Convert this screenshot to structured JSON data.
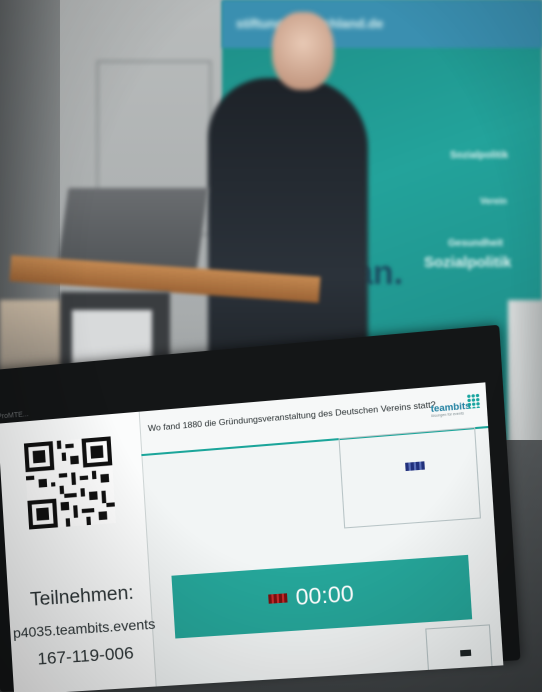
{
  "photo": {
    "description_colors": {
      "banner": "#23a39b",
      "accent": "#1ba59a",
      "timer_bar": "#26a69a"
    }
  },
  "banner": {
    "top_text": "stiftung-deutschland.de",
    "word_1": "Sozialpolitik",
    "word_2": "Verein",
    "word_3": "Gesundheit",
    "word_4": "Sozialpolitik",
    "word_5": "an."
  },
  "monitor": {
    "brand": "ProMTE..."
  },
  "screen": {
    "question": "Wo fand 1880 die Gründungsveranstaltung des Deutschen Vereins statt?",
    "logo": "teambits",
    "logo_sub": "lösungen für events",
    "join_label": "Teilnehmen:",
    "join_url": "p4035.teambits.events",
    "join_code": "167-119-006",
    "timer": "00:00"
  }
}
